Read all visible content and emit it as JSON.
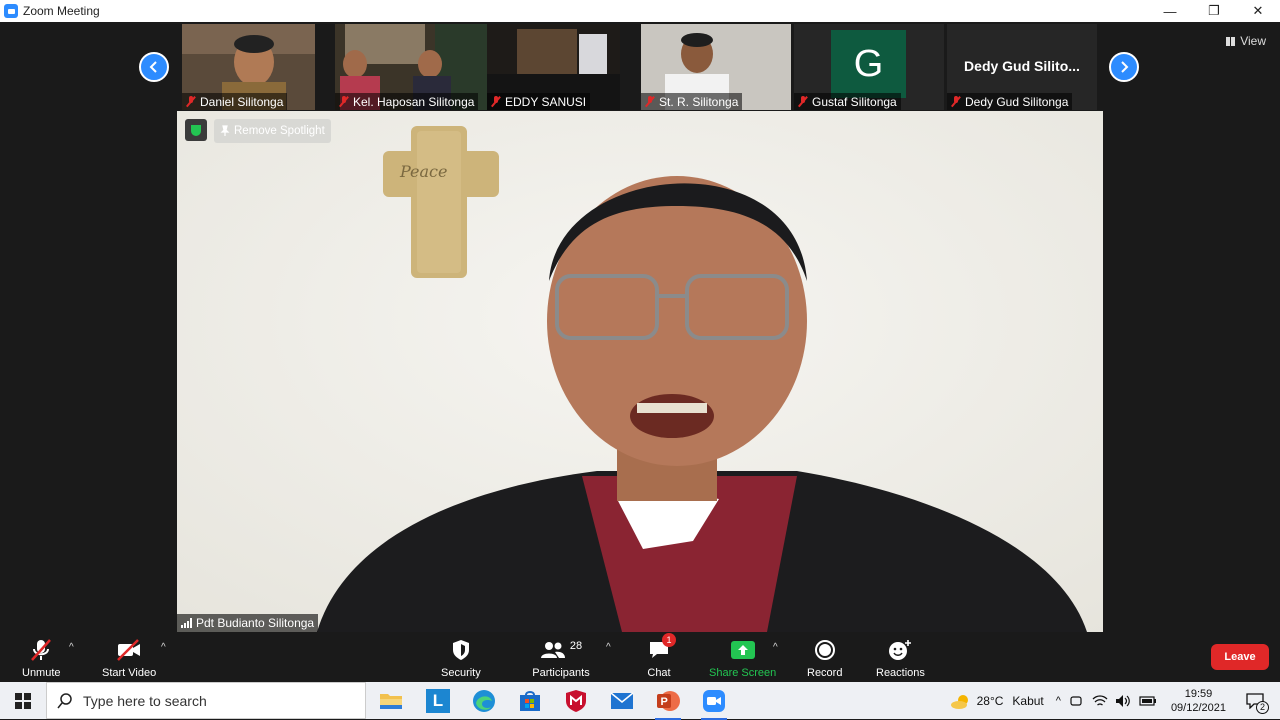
{
  "window": {
    "title": "Zoom Meeting",
    "minimize": "—",
    "restore": "❐",
    "close": "✕"
  },
  "gallery": {
    "view_label": "View",
    "participants": [
      {
        "name": "Daniel Silitonga",
        "muted": true
      },
      {
        "name": "Kel. Haposan Silitonga",
        "muted": true
      },
      {
        "name": "EDDY SANUSI",
        "muted": true
      },
      {
        "name": "St. R. Silitonga",
        "muted": true
      },
      {
        "name": "Gustaf Silitonga",
        "muted": true,
        "avatar_letter": "G",
        "avatar_color": "#0e5a3f"
      },
      {
        "name": "Dedy Gud Silitonga",
        "muted": true,
        "display_title": "Dedy Gud Silito..."
      }
    ]
  },
  "spotlight": {
    "remove_label": "Remove Spotlight",
    "speaker_name": "Pdt Budianto Silitonga",
    "cross_text": "Peace"
  },
  "toolbar": {
    "unmute": "Unmute",
    "start_video": "Start Video",
    "security": "Security",
    "participants": "Participants",
    "participants_count": "28",
    "chat": "Chat",
    "chat_badge": "1",
    "share_screen": "Share Screen",
    "record": "Record",
    "reactions": "Reactions",
    "leave": "Leave",
    "accent_green": "#23c552",
    "leave_color": "#e02828"
  },
  "taskbar": {
    "search_placeholder": "Type here to search",
    "weather_temp": "28°C",
    "weather_desc": "Kabut",
    "time": "19:59",
    "date": "09/12/2021",
    "notification_count": "2"
  }
}
